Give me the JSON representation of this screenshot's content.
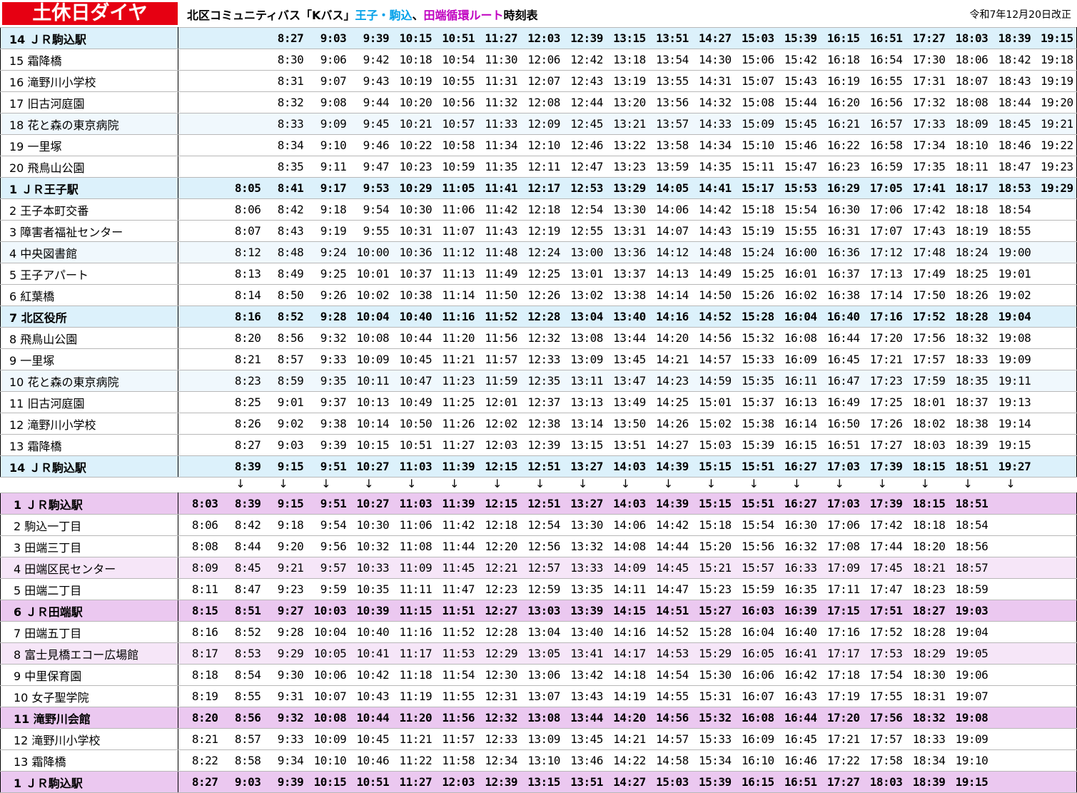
{
  "header": {
    "badge": "土休日ダイヤ",
    "title_part1": "北区コミュニティバス「Kバス」",
    "title_part2": "王子・駒込",
    "title_part3": "、",
    "title_part4": "田端循環ルート",
    "title_part5": "時刻表",
    "revision": "令和7年12月20日改正"
  },
  "colors": {
    "badge_red": "#e60012",
    "oji_komagome_cyan": "#00a0e9",
    "tabata_magenta": "#c000c0",
    "section1_major_row": "#dcf1fb",
    "section1_light_row": "#f0f8fd",
    "section2_major_row": "#ebc8f0",
    "section2_light_row": "#f6e6f8"
  },
  "icons": {
    "arrow_down": "↓"
  },
  "section1": {
    "rows": [
      {
        "stop": "14 ＪＲ駒込駅",
        "style": "em",
        "times": [
          "",
          "",
          "8:27",
          "9:03",
          "9:39",
          "10:15",
          "10:51",
          "11:27",
          "12:03",
          "12:39",
          "13:15",
          "13:51",
          "14:27",
          "15:03",
          "15:39",
          "16:15",
          "16:51",
          "17:27",
          "18:03",
          "18:39",
          "19:15"
        ]
      },
      {
        "stop": "15 霜降橋",
        "style": "",
        "times": [
          "",
          "",
          "8:30",
          "9:06",
          "9:42",
          "10:18",
          "10:54",
          "11:30",
          "12:06",
          "12:42",
          "13:18",
          "13:54",
          "14:30",
          "15:06",
          "15:42",
          "16:18",
          "16:54",
          "17:30",
          "18:06",
          "18:42",
          "19:18"
        ]
      },
      {
        "stop": "16 滝野川小学校",
        "style": "",
        "times": [
          "",
          "",
          "8:31",
          "9:07",
          "9:43",
          "10:19",
          "10:55",
          "11:31",
          "12:07",
          "12:43",
          "13:19",
          "13:55",
          "14:31",
          "15:07",
          "15:43",
          "16:19",
          "16:55",
          "17:31",
          "18:07",
          "18:43",
          "19:19"
        ]
      },
      {
        "stop": "17 旧古河庭園",
        "style": "",
        "times": [
          "",
          "",
          "8:32",
          "9:08",
          "9:44",
          "10:20",
          "10:56",
          "11:32",
          "12:08",
          "12:44",
          "13:20",
          "13:56",
          "14:32",
          "15:08",
          "15:44",
          "16:20",
          "16:56",
          "17:32",
          "18:08",
          "18:44",
          "19:20"
        ]
      },
      {
        "stop": "18 花と森の東京病院",
        "style": "lt",
        "times": [
          "",
          "",
          "8:33",
          "9:09",
          "9:45",
          "10:21",
          "10:57",
          "11:33",
          "12:09",
          "12:45",
          "13:21",
          "13:57",
          "14:33",
          "15:09",
          "15:45",
          "16:21",
          "16:57",
          "17:33",
          "18:09",
          "18:45",
          "19:21"
        ]
      },
      {
        "stop": "19 一里塚",
        "style": "",
        "times": [
          "",
          "",
          "8:34",
          "9:10",
          "9:46",
          "10:22",
          "10:58",
          "11:34",
          "12:10",
          "12:46",
          "13:22",
          "13:58",
          "14:34",
          "15:10",
          "15:46",
          "16:22",
          "16:58",
          "17:34",
          "18:10",
          "18:46",
          "19:22"
        ]
      },
      {
        "stop": "20 飛鳥山公園",
        "style": "",
        "times": [
          "",
          "",
          "8:35",
          "9:11",
          "9:47",
          "10:23",
          "10:59",
          "11:35",
          "12:11",
          "12:47",
          "13:23",
          "13:59",
          "14:35",
          "15:11",
          "15:47",
          "16:23",
          "16:59",
          "17:35",
          "18:11",
          "18:47",
          "19:23"
        ]
      },
      {
        "stop": "1 ＪＲ王子駅",
        "style": "em",
        "times": [
          "",
          "8:05",
          "8:41",
          "9:17",
          "9:53",
          "10:29",
          "11:05",
          "11:41",
          "12:17",
          "12:53",
          "13:29",
          "14:05",
          "14:41",
          "15:17",
          "15:53",
          "16:29",
          "17:05",
          "17:41",
          "18:17",
          "18:53",
          "19:29"
        ]
      },
      {
        "stop": "2 王子本町交番",
        "style": "",
        "times": [
          "",
          "8:06",
          "8:42",
          "9:18",
          "9:54",
          "10:30",
          "11:06",
          "11:42",
          "12:18",
          "12:54",
          "13:30",
          "14:06",
          "14:42",
          "15:18",
          "15:54",
          "16:30",
          "17:06",
          "17:42",
          "18:18",
          "18:54",
          ""
        ]
      },
      {
        "stop": "3 障害者福祉センター",
        "style": "",
        "times": [
          "",
          "8:07",
          "8:43",
          "9:19",
          "9:55",
          "10:31",
          "11:07",
          "11:43",
          "12:19",
          "12:55",
          "13:31",
          "14:07",
          "14:43",
          "15:19",
          "15:55",
          "16:31",
          "17:07",
          "17:43",
          "18:19",
          "18:55",
          ""
        ]
      },
      {
        "stop": "4 中央図書館",
        "style": "lt",
        "times": [
          "",
          "8:12",
          "8:48",
          "9:24",
          "10:00",
          "10:36",
          "11:12",
          "11:48",
          "12:24",
          "13:00",
          "13:36",
          "14:12",
          "14:48",
          "15:24",
          "16:00",
          "16:36",
          "17:12",
          "17:48",
          "18:24",
          "19:00",
          ""
        ]
      },
      {
        "stop": "5 王子アパート",
        "style": "",
        "times": [
          "",
          "8:13",
          "8:49",
          "9:25",
          "10:01",
          "10:37",
          "11:13",
          "11:49",
          "12:25",
          "13:01",
          "13:37",
          "14:13",
          "14:49",
          "15:25",
          "16:01",
          "16:37",
          "17:13",
          "17:49",
          "18:25",
          "19:01",
          ""
        ]
      },
      {
        "stop": "6 紅葉橋",
        "style": "",
        "times": [
          "",
          "8:14",
          "8:50",
          "9:26",
          "10:02",
          "10:38",
          "11:14",
          "11:50",
          "12:26",
          "13:02",
          "13:38",
          "14:14",
          "14:50",
          "15:26",
          "16:02",
          "16:38",
          "17:14",
          "17:50",
          "18:26",
          "19:02",
          ""
        ]
      },
      {
        "stop": "7 北区役所",
        "style": "em",
        "times": [
          "",
          "8:16",
          "8:52",
          "9:28",
          "10:04",
          "10:40",
          "11:16",
          "11:52",
          "12:28",
          "13:04",
          "13:40",
          "14:16",
          "14:52",
          "15:28",
          "16:04",
          "16:40",
          "17:16",
          "17:52",
          "18:28",
          "19:04",
          ""
        ]
      },
      {
        "stop": "8 飛鳥山公園",
        "style": "",
        "times": [
          "",
          "8:20",
          "8:56",
          "9:32",
          "10:08",
          "10:44",
          "11:20",
          "11:56",
          "12:32",
          "13:08",
          "13:44",
          "14:20",
          "14:56",
          "15:32",
          "16:08",
          "16:44",
          "17:20",
          "17:56",
          "18:32",
          "19:08",
          ""
        ]
      },
      {
        "stop": "9 一里塚",
        "style": "",
        "times": [
          "",
          "8:21",
          "8:57",
          "9:33",
          "10:09",
          "10:45",
          "11:21",
          "11:57",
          "12:33",
          "13:09",
          "13:45",
          "14:21",
          "14:57",
          "15:33",
          "16:09",
          "16:45",
          "17:21",
          "17:57",
          "18:33",
          "19:09",
          ""
        ]
      },
      {
        "stop": "10 花と森の東京病院",
        "style": "lt",
        "times": [
          "",
          "8:23",
          "8:59",
          "9:35",
          "10:11",
          "10:47",
          "11:23",
          "11:59",
          "12:35",
          "13:11",
          "13:47",
          "14:23",
          "14:59",
          "15:35",
          "16:11",
          "16:47",
          "17:23",
          "17:59",
          "18:35",
          "19:11",
          ""
        ]
      },
      {
        "stop": "11 旧古河庭園",
        "style": "",
        "times": [
          "",
          "8:25",
          "9:01",
          "9:37",
          "10:13",
          "10:49",
          "11:25",
          "12:01",
          "12:37",
          "13:13",
          "13:49",
          "14:25",
          "15:01",
          "15:37",
          "16:13",
          "16:49",
          "17:25",
          "18:01",
          "18:37",
          "19:13",
          ""
        ]
      },
      {
        "stop": "12 滝野川小学校",
        "style": "",
        "times": [
          "",
          "8:26",
          "9:02",
          "9:38",
          "10:14",
          "10:50",
          "11:26",
          "12:02",
          "12:38",
          "13:14",
          "13:50",
          "14:26",
          "15:02",
          "15:38",
          "16:14",
          "16:50",
          "17:26",
          "18:02",
          "18:38",
          "19:14",
          ""
        ]
      },
      {
        "stop": "13 霜降橋",
        "style": "",
        "times": [
          "",
          "8:27",
          "9:03",
          "9:39",
          "10:15",
          "10:51",
          "11:27",
          "12:03",
          "12:39",
          "13:15",
          "13:51",
          "14:27",
          "15:03",
          "15:39",
          "16:15",
          "16:51",
          "17:27",
          "18:03",
          "18:39",
          "19:15",
          ""
        ]
      },
      {
        "stop": "14 ＪＲ駒込駅",
        "style": "em",
        "times": [
          "",
          "8:39",
          "9:15",
          "9:51",
          "10:27",
          "11:03",
          "11:39",
          "12:15",
          "12:51",
          "13:27",
          "14:03",
          "14:39",
          "15:15",
          "15:51",
          "16:27",
          "17:03",
          "17:39",
          "18:15",
          "18:51",
          "19:27",
          ""
        ]
      }
    ]
  },
  "section2": {
    "rows": [
      {
        "stop": "1 ＪＲ駒込駅",
        "style": "em",
        "times": [
          "8:03",
          "8:39",
          "9:15",
          "9:51",
          "10:27",
          "11:03",
          "11:39",
          "12:15",
          "12:51",
          "13:27",
          "14:03",
          "14:39",
          "15:15",
          "15:51",
          "16:27",
          "17:03",
          "17:39",
          "18:15",
          "18:51",
          ""
        ]
      },
      {
        "stop": "2 駒込一丁目",
        "style": "",
        "times": [
          "8:06",
          "8:42",
          "9:18",
          "9:54",
          "10:30",
          "11:06",
          "11:42",
          "12:18",
          "12:54",
          "13:30",
          "14:06",
          "14:42",
          "15:18",
          "15:54",
          "16:30",
          "17:06",
          "17:42",
          "18:18",
          "18:54",
          ""
        ]
      },
      {
        "stop": "3 田端三丁目",
        "style": "",
        "times": [
          "8:08",
          "8:44",
          "9:20",
          "9:56",
          "10:32",
          "11:08",
          "11:44",
          "12:20",
          "12:56",
          "13:32",
          "14:08",
          "14:44",
          "15:20",
          "15:56",
          "16:32",
          "17:08",
          "17:44",
          "18:20",
          "18:56",
          ""
        ]
      },
      {
        "stop": "4 田端区民センター",
        "style": "lt",
        "times": [
          "8:09",
          "8:45",
          "9:21",
          "9:57",
          "10:33",
          "11:09",
          "11:45",
          "12:21",
          "12:57",
          "13:33",
          "14:09",
          "14:45",
          "15:21",
          "15:57",
          "16:33",
          "17:09",
          "17:45",
          "18:21",
          "18:57",
          ""
        ]
      },
      {
        "stop": "5 田端二丁目",
        "style": "",
        "times": [
          "8:11",
          "8:47",
          "9:23",
          "9:59",
          "10:35",
          "11:11",
          "11:47",
          "12:23",
          "12:59",
          "13:35",
          "14:11",
          "14:47",
          "15:23",
          "15:59",
          "16:35",
          "17:11",
          "17:47",
          "18:23",
          "18:59",
          ""
        ]
      },
      {
        "stop": "6 ＪＲ田端駅",
        "style": "em",
        "times": [
          "8:15",
          "8:51",
          "9:27",
          "10:03",
          "10:39",
          "11:15",
          "11:51",
          "12:27",
          "13:03",
          "13:39",
          "14:15",
          "14:51",
          "15:27",
          "16:03",
          "16:39",
          "17:15",
          "17:51",
          "18:27",
          "19:03",
          ""
        ]
      },
      {
        "stop": "7 田端五丁目",
        "style": "",
        "times": [
          "8:16",
          "8:52",
          "9:28",
          "10:04",
          "10:40",
          "11:16",
          "11:52",
          "12:28",
          "13:04",
          "13:40",
          "14:16",
          "14:52",
          "15:28",
          "16:04",
          "16:40",
          "17:16",
          "17:52",
          "18:28",
          "19:04",
          ""
        ]
      },
      {
        "stop": "8 富士見橋エコー広場館",
        "style": "lt",
        "times": [
          "8:17",
          "8:53",
          "9:29",
          "10:05",
          "10:41",
          "11:17",
          "11:53",
          "12:29",
          "13:05",
          "13:41",
          "14:17",
          "14:53",
          "15:29",
          "16:05",
          "16:41",
          "17:17",
          "17:53",
          "18:29",
          "19:05",
          ""
        ]
      },
      {
        "stop": "9 中里保育園",
        "style": "",
        "times": [
          "8:18",
          "8:54",
          "9:30",
          "10:06",
          "10:42",
          "11:18",
          "11:54",
          "12:30",
          "13:06",
          "13:42",
          "14:18",
          "14:54",
          "15:30",
          "16:06",
          "16:42",
          "17:18",
          "17:54",
          "18:30",
          "19:06",
          ""
        ]
      },
      {
        "stop": "10 女子聖学院",
        "style": "",
        "times": [
          "8:19",
          "8:55",
          "9:31",
          "10:07",
          "10:43",
          "11:19",
          "11:55",
          "12:31",
          "13:07",
          "13:43",
          "14:19",
          "14:55",
          "15:31",
          "16:07",
          "16:43",
          "17:19",
          "17:55",
          "18:31",
          "19:07",
          ""
        ]
      },
      {
        "stop": "11 滝野川会館",
        "style": "em",
        "times": [
          "8:20",
          "8:56",
          "9:32",
          "10:08",
          "10:44",
          "11:20",
          "11:56",
          "12:32",
          "13:08",
          "13:44",
          "14:20",
          "14:56",
          "15:32",
          "16:08",
          "16:44",
          "17:20",
          "17:56",
          "18:32",
          "19:08",
          ""
        ]
      },
      {
        "stop": "12 滝野川小学校",
        "style": "",
        "times": [
          "8:21",
          "8:57",
          "9:33",
          "10:09",
          "10:45",
          "11:21",
          "11:57",
          "12:33",
          "13:09",
          "13:45",
          "14:21",
          "14:57",
          "15:33",
          "16:09",
          "16:45",
          "17:21",
          "17:57",
          "18:33",
          "19:09",
          ""
        ]
      },
      {
        "stop": "13 霜降橋",
        "style": "",
        "times": [
          "8:22",
          "8:58",
          "9:34",
          "10:10",
          "10:46",
          "11:22",
          "11:58",
          "12:34",
          "13:10",
          "13:46",
          "14:22",
          "14:58",
          "15:34",
          "16:10",
          "16:46",
          "17:22",
          "17:58",
          "18:34",
          "19:10",
          ""
        ]
      },
      {
        "stop": "1 ＪＲ駒込駅",
        "style": "em",
        "times": [
          "8:27",
          "9:03",
          "9:39",
          "10:15",
          "10:51",
          "11:27",
          "12:03",
          "12:39",
          "13:15",
          "13:51",
          "14:27",
          "15:03",
          "15:39",
          "16:15",
          "16:51",
          "17:27",
          "18:03",
          "18:39",
          "19:15",
          ""
        ]
      }
    ]
  }
}
